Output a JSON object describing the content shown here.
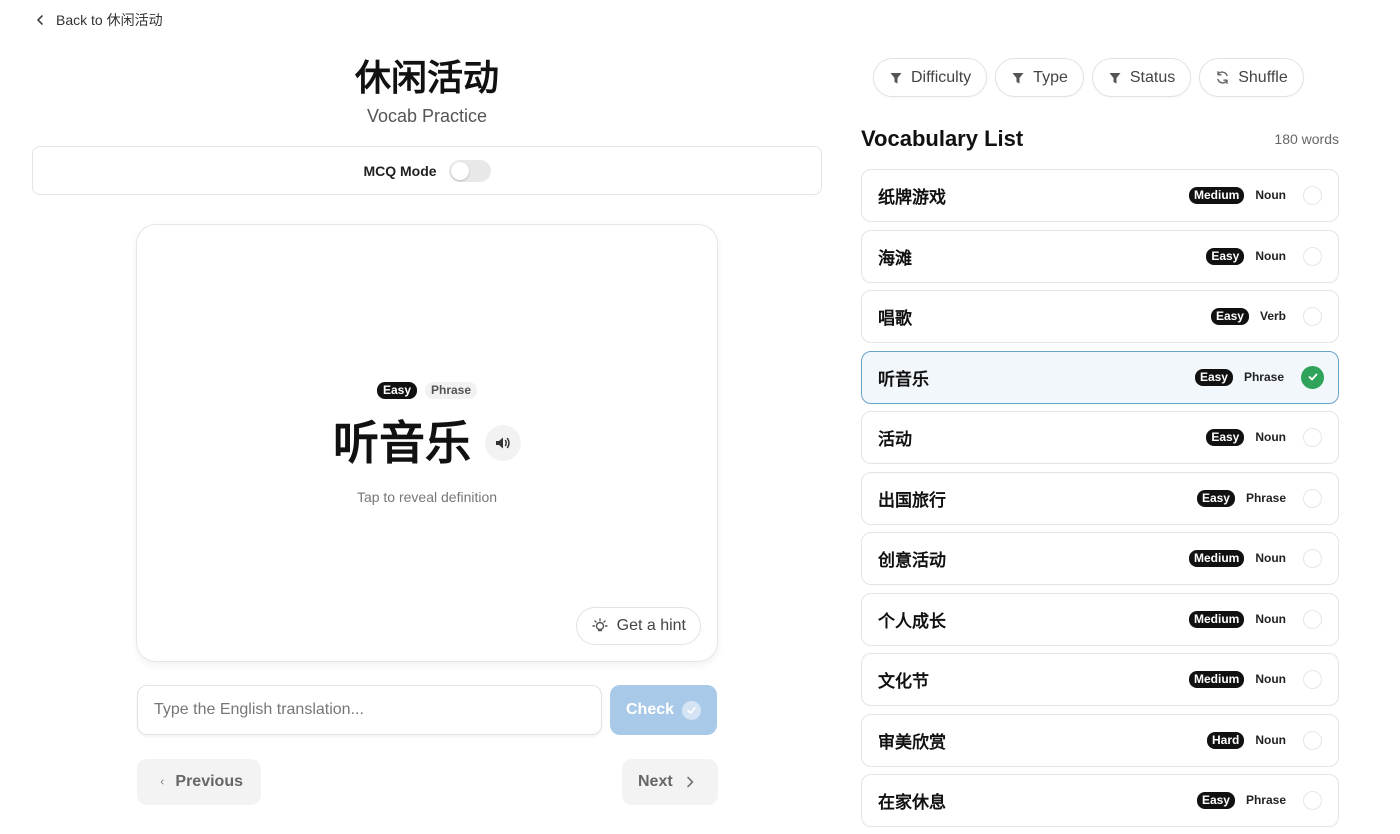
{
  "back_link": {
    "label": "Back to 休闲活动"
  },
  "header": {
    "title": "休闲活动",
    "subtitle": "Vocab Practice"
  },
  "mode": {
    "label": "MCQ Mode",
    "enabled": false
  },
  "card": {
    "difficulty": "Easy",
    "type": "Phrase",
    "word": "听音乐",
    "reveal_text": "Tap to reveal definition",
    "hint_label": "Get a hint"
  },
  "answer": {
    "placeholder": "Type the English translation...",
    "value": "",
    "check_label": "Check"
  },
  "nav": {
    "previous_label": "Previous",
    "next_label": "Next"
  },
  "filters": {
    "difficulty": "Difficulty",
    "type": "Type",
    "status": "Status",
    "shuffle": "Shuffle"
  },
  "vocab_list": {
    "title": "Vocabulary List",
    "count": "180 words",
    "items": [
      {
        "word": "纸牌游戏",
        "difficulty": "Medium",
        "type": "Noun",
        "done": false
      },
      {
        "word": "海滩",
        "difficulty": "Easy",
        "type": "Noun",
        "done": false
      },
      {
        "word": "唱歌",
        "difficulty": "Easy",
        "type": "Verb",
        "done": false
      },
      {
        "word": "听音乐",
        "difficulty": "Easy",
        "type": "Phrase",
        "done": true,
        "selected": true
      },
      {
        "word": "活动",
        "difficulty": "Easy",
        "type": "Noun",
        "done": false
      },
      {
        "word": "出国旅行",
        "difficulty": "Easy",
        "type": "Phrase",
        "done": false
      },
      {
        "word": "创意活动",
        "difficulty": "Medium",
        "type": "Noun",
        "done": false
      },
      {
        "word": "个人成长",
        "difficulty": "Medium",
        "type": "Noun",
        "done": false
      },
      {
        "word": "文化节",
        "difficulty": "Medium",
        "type": "Noun",
        "done": false
      },
      {
        "word": "审美欣赏",
        "difficulty": "Hard",
        "type": "Noun",
        "done": false
      },
      {
        "word": "在家休息",
        "difficulty": "Easy",
        "type": "Phrase",
        "done": false
      }
    ]
  },
  "colors": {
    "accent_light": "#a8c9e8",
    "success": "#2fa35a",
    "selected_border": "#6aa3cc"
  }
}
